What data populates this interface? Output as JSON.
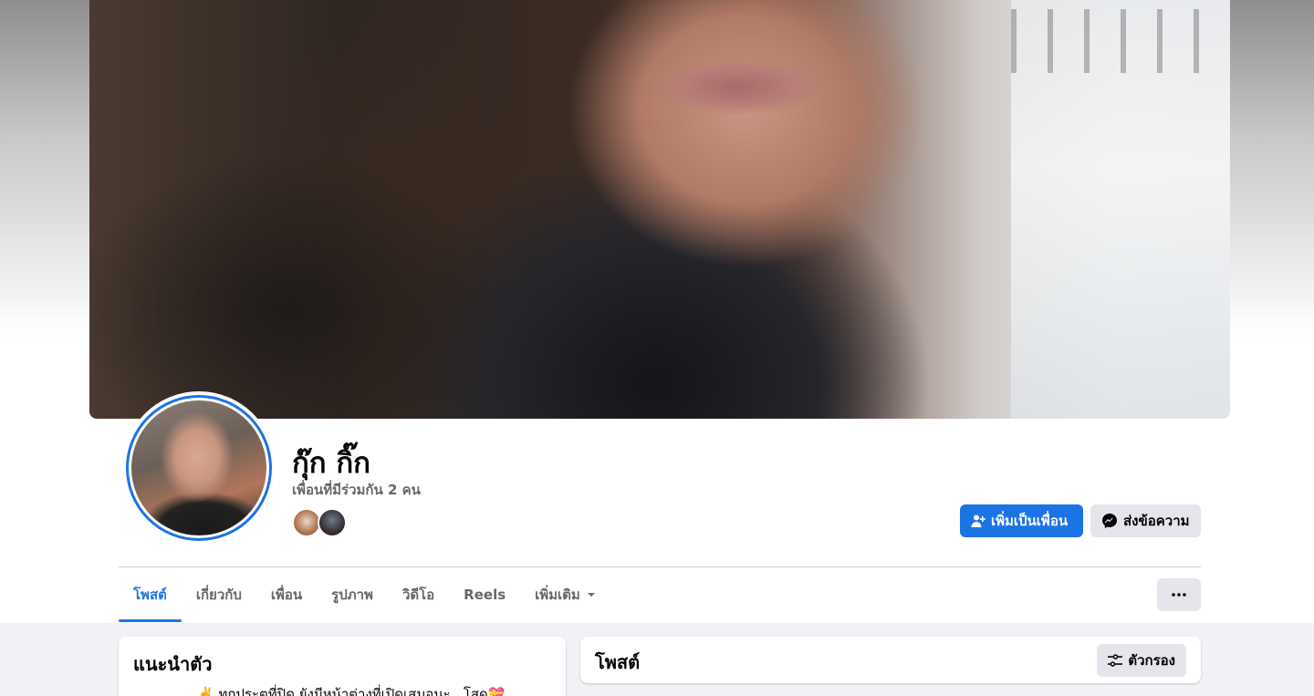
{
  "profile": {
    "name": "กุ๊ก กิ๊ก",
    "mutual_friends": "เพื่อนที่มีร่วมกัน 2 คน"
  },
  "actions": {
    "add_friend_label": "เพิ่มเป็นเพื่อน",
    "message_label": "ส่งข้อความ"
  },
  "tabs": [
    {
      "label": "โพสต์",
      "active": true
    },
    {
      "label": "เกี่ยวกับ"
    },
    {
      "label": "เพื่อน"
    },
    {
      "label": "รูปภาพ"
    },
    {
      "label": "วิดีโอ"
    },
    {
      "label": "Reels"
    },
    {
      "label": "เพิ่มเติม"
    }
  ],
  "intro": {
    "title": "แนะนำตัว",
    "bio": "✌️ ทุกประตูที่ปิด ยังมีหน้าต่างที่เปิดเสมอนะ.. โสด💝"
  },
  "posts": {
    "title": "โพสต์",
    "filter_label": "ตัวกรอง"
  },
  "colors": {
    "accent": "#1b74e4",
    "secondary_button": "#e4e6eb",
    "page_background": "#f0f2f5",
    "muted_text": "#65676b"
  },
  "icons": {
    "add_friend": "add-friend-icon",
    "messenger": "messenger-icon",
    "dropdown": "caret-down-icon",
    "more": "more-dots-icon",
    "filter": "filter-icon"
  }
}
